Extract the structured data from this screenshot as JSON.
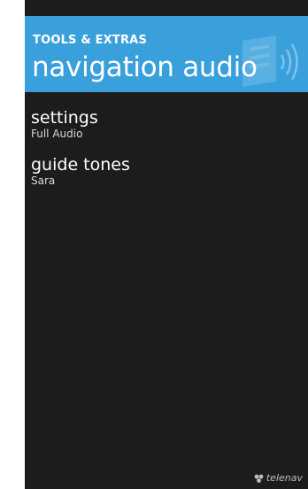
{
  "header": {
    "section_label": "TOOLS & EXTRAS",
    "title": "navigation audio",
    "background_color": "#3aa0dc"
  },
  "items": [
    {
      "title": "settings",
      "value": "Full Audio"
    },
    {
      "title": "guide tones",
      "value": "Sara"
    }
  ],
  "footer": {
    "brand": "telenav",
    "brand_icon": "telenav-logo-icon"
  },
  "colors": {
    "background": "#1c1c1c",
    "text_primary": "#ffffff",
    "text_secondary": "#d8d8d8"
  }
}
